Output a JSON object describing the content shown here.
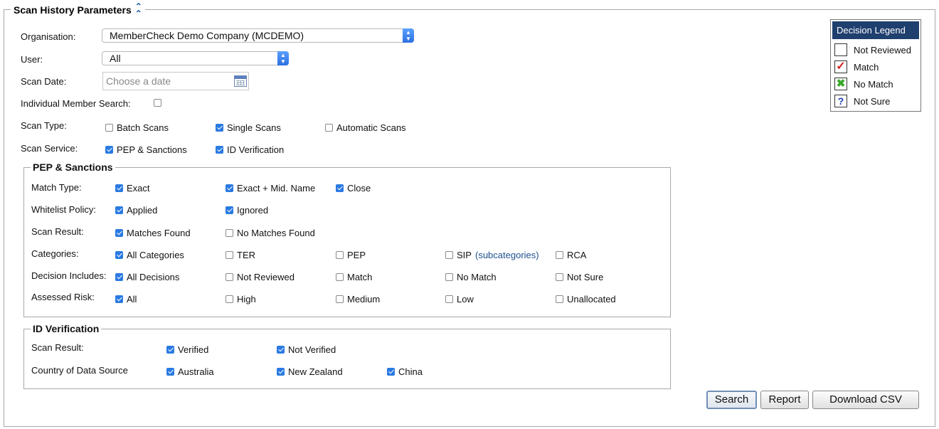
{
  "section_title": "Scan History Parameters",
  "organisation": {
    "label": "Organisation:",
    "value": "MemberCheck Demo Company (MCDEMO)"
  },
  "user": {
    "label": "User:",
    "value": "All"
  },
  "scan_date": {
    "label": "Scan Date:",
    "placeholder": "Choose a date"
  },
  "individual_member_search": {
    "label": "Individual Member Search:",
    "checked": false
  },
  "scan_type": {
    "label": "Scan Type:",
    "options": [
      {
        "label": "Batch Scans",
        "checked": false
      },
      {
        "label": "Single Scans",
        "checked": true
      },
      {
        "label": "Automatic Scans",
        "checked": false
      }
    ]
  },
  "scan_service": {
    "label": "Scan Service:",
    "options": [
      {
        "label": "PEP & Sanctions",
        "checked": true
      },
      {
        "label": "ID Verification",
        "checked": true
      }
    ]
  },
  "pep": {
    "title": "PEP & Sanctions",
    "match_type": {
      "label": "Match Type:",
      "options": [
        {
          "label": "Exact",
          "checked": true
        },
        {
          "label": "Exact + Mid. Name",
          "checked": true
        },
        {
          "label": "Close",
          "checked": true
        }
      ]
    },
    "whitelist_policy": {
      "label": "Whitelist Policy:",
      "options": [
        {
          "label": "Applied",
          "checked": true
        },
        {
          "label": "Ignored",
          "checked": true
        }
      ]
    },
    "scan_result": {
      "label": "Scan Result:",
      "options": [
        {
          "label": "Matches Found",
          "checked": true
        },
        {
          "label": "No Matches Found",
          "checked": false
        }
      ]
    },
    "categories": {
      "label": "Categories:",
      "subcategories_link": "(subcategories)",
      "options": [
        {
          "label": "All Categories",
          "checked": true
        },
        {
          "label": "TER",
          "checked": false
        },
        {
          "label": "PEP",
          "checked": false
        },
        {
          "label": "SIP",
          "checked": false
        },
        {
          "label": "RCA",
          "checked": false
        }
      ]
    },
    "decision_includes": {
      "label": "Decision Includes:",
      "options": [
        {
          "label": "All Decisions",
          "checked": true
        },
        {
          "label": "Not Reviewed",
          "checked": false
        },
        {
          "label": "Match",
          "checked": false
        },
        {
          "label": "No Match",
          "checked": false
        },
        {
          "label": "Not Sure",
          "checked": false
        }
      ]
    },
    "assessed_risk": {
      "label": "Assessed Risk:",
      "options": [
        {
          "label": "All",
          "checked": true
        },
        {
          "label": "High",
          "checked": false
        },
        {
          "label": "Medium",
          "checked": false
        },
        {
          "label": "Low",
          "checked": false
        },
        {
          "label": "Unallocated",
          "checked": false
        }
      ]
    }
  },
  "idv": {
    "title": "ID Verification",
    "scan_result": {
      "label": "Scan Result:",
      "options": [
        {
          "label": "Verified",
          "checked": true
        },
        {
          "label": "Not Verified",
          "checked": true
        }
      ]
    },
    "country": {
      "label": "Country of Data Source",
      "options": [
        {
          "label": "Australia",
          "checked": true
        },
        {
          "label": "New Zealand",
          "checked": true
        },
        {
          "label": "China",
          "checked": true
        }
      ]
    }
  },
  "decision_legend": {
    "title": "Decision Legend",
    "items": [
      {
        "label": "Not Reviewed",
        "icon": "empty-box-icon"
      },
      {
        "label": "Match",
        "icon": "red-check-icon",
        "color": "#d62020"
      },
      {
        "label": "No Match",
        "icon": "green-x-icon",
        "color": "#3aa82a"
      },
      {
        "label": "Not Sure",
        "icon": "question-mark-icon",
        "color": "#1f3fb0"
      }
    ]
  },
  "buttons": {
    "search": "Search",
    "report": "Report",
    "download_csv": "Download CSV"
  }
}
